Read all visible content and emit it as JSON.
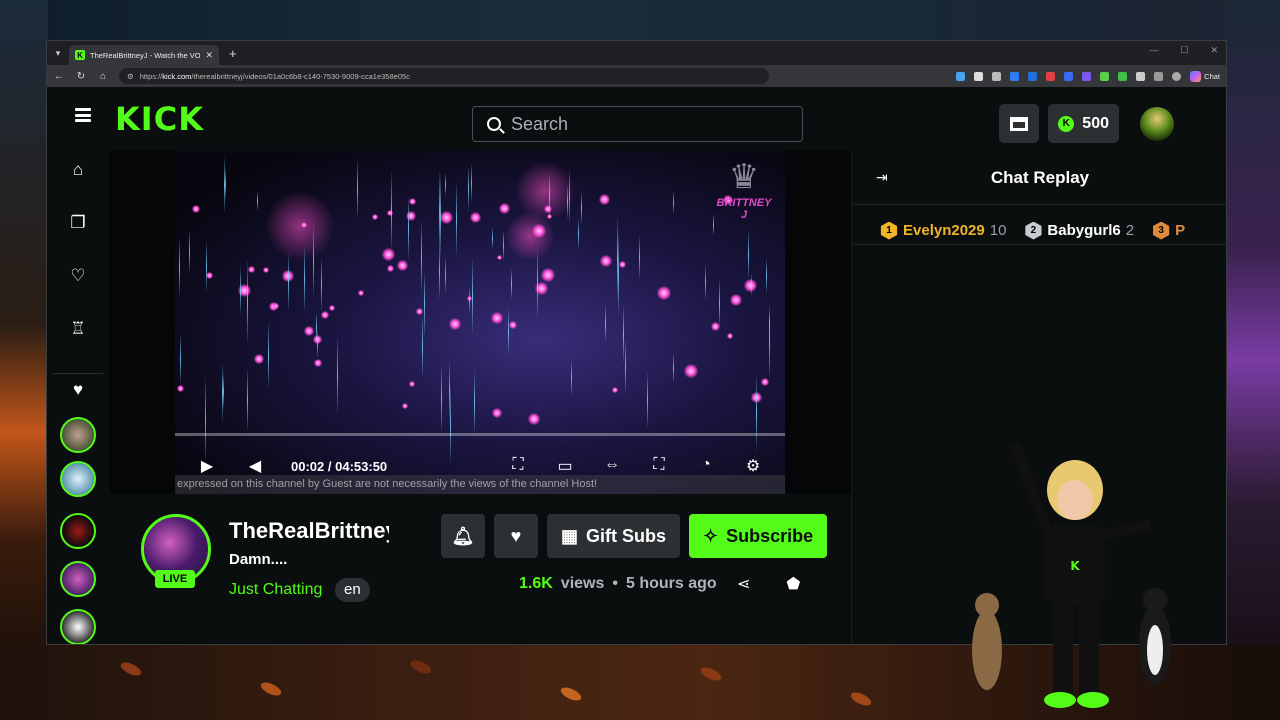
{
  "browser": {
    "tab_title": "TheRealBrittneyJ - Watch the VOD",
    "tab_close": "✕",
    "new_tab": "+",
    "url_host": "kick.com",
    "url_path": "/therealbrittneyj/videos/01a0c6b8-c140-7530-9009-cca1e358e05c",
    "url_prefix": "https://",
    "chat_label": "Chat"
  },
  "header": {
    "logo": "KICK",
    "search_placeholder": "Search",
    "kicks_count": "500"
  },
  "video": {
    "time_current": "00:02",
    "time_separator": "/",
    "time_total": "04:53:50",
    "watermark": "BRITTNEY J",
    "ticker": "expressed on this channel by Guest are not necessarily the views of the channel Host!"
  },
  "chat": {
    "title": "Chat Replay",
    "leaderboard": [
      {
        "rank": "1",
        "name": "Evelyn2029",
        "count": "10",
        "color": "#f0b429",
        "name_color": "#f0b429"
      },
      {
        "rank": "2",
        "name": "Babygurl6",
        "count": "2",
        "color": "#c8ccd0",
        "name_color": "#ffffff"
      },
      {
        "rank": "3",
        "name": "P",
        "count": "",
        "color": "#e08a3c",
        "name_color": "#e08a3c"
      }
    ]
  },
  "channel": {
    "name": "TheRealBrittney",
    "live_badge": "LIVE",
    "vod_title": "Damn....",
    "category": "Just Chatting",
    "language": "en",
    "gift_label": "Gift Subs",
    "subscribe_label": "Subscribe",
    "views_value": "1.6K",
    "views_label": "views",
    "separator": "•",
    "time_ago": "5 hours ago"
  },
  "colors": {
    "accent": "#53fc18",
    "background": "#0b0e0f",
    "surface": "#2d3033"
  }
}
